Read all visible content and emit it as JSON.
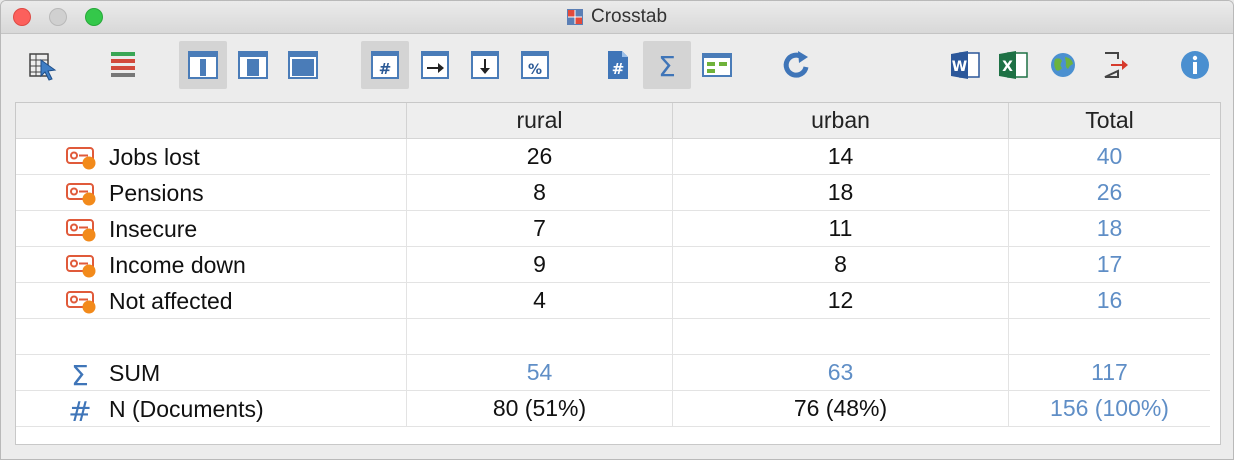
{
  "window": {
    "title": "Crosstab"
  },
  "toolbar": {
    "buttons": [
      {
        "name": "select-documents",
        "icon": "table-cursor-icon"
      },
      {
        "name": "code-list",
        "icon": "code-stack-icon"
      },
      {
        "name": "view-narrow",
        "icon": "view-narrow-icon"
      },
      {
        "name": "view-medium",
        "icon": "view-medium-icon"
      },
      {
        "name": "view-wide",
        "icon": "view-wide-icon"
      },
      {
        "name": "show-counts",
        "icon": "hash-icon"
      },
      {
        "name": "row-percent",
        "icon": "arrow-right-icon"
      },
      {
        "name": "column-percent",
        "icon": "arrow-down-icon"
      },
      {
        "name": "percent",
        "icon": "percent-icon"
      },
      {
        "name": "document-count",
        "icon": "document-hash-icon"
      },
      {
        "name": "sum",
        "icon": "sigma-icon"
      },
      {
        "name": "cluster",
        "icon": "cluster-icon"
      },
      {
        "name": "refresh",
        "icon": "refresh-icon"
      },
      {
        "name": "export-word",
        "icon": "word-icon"
      },
      {
        "name": "export-excel",
        "icon": "excel-icon"
      },
      {
        "name": "export-html",
        "icon": "globe-icon"
      },
      {
        "name": "export",
        "icon": "export-icon"
      },
      {
        "name": "info",
        "icon": "info-icon"
      }
    ]
  },
  "table": {
    "columns": [
      "rural",
      "urban",
      "Total"
    ],
    "rows": [
      {
        "label": "Jobs lost",
        "rural": "26",
        "urban": "14",
        "total": "40"
      },
      {
        "label": "Pensions",
        "rural": "8",
        "urban": "18",
        "total": "26"
      },
      {
        "label": "Insecure",
        "rural": "7",
        "urban": "11",
        "total": "18"
      },
      {
        "label": "Income down",
        "rural": "9",
        "urban": "8",
        "total": "17"
      },
      {
        "label": "Not affected",
        "rural": "4",
        "urban": "12",
        "total": "16"
      }
    ],
    "sum": {
      "label": "SUM",
      "rural": "54",
      "urban": "63",
      "total": "117"
    },
    "n": {
      "label": "N (Documents)",
      "rural": "80 (51%)",
      "urban": "76 (48%)",
      "total": "156 (100%)"
    }
  },
  "colors": {
    "accent_blue": "#5f8ec6",
    "code_icon": "#e05a3a",
    "code_dot": "#f28a1b"
  }
}
